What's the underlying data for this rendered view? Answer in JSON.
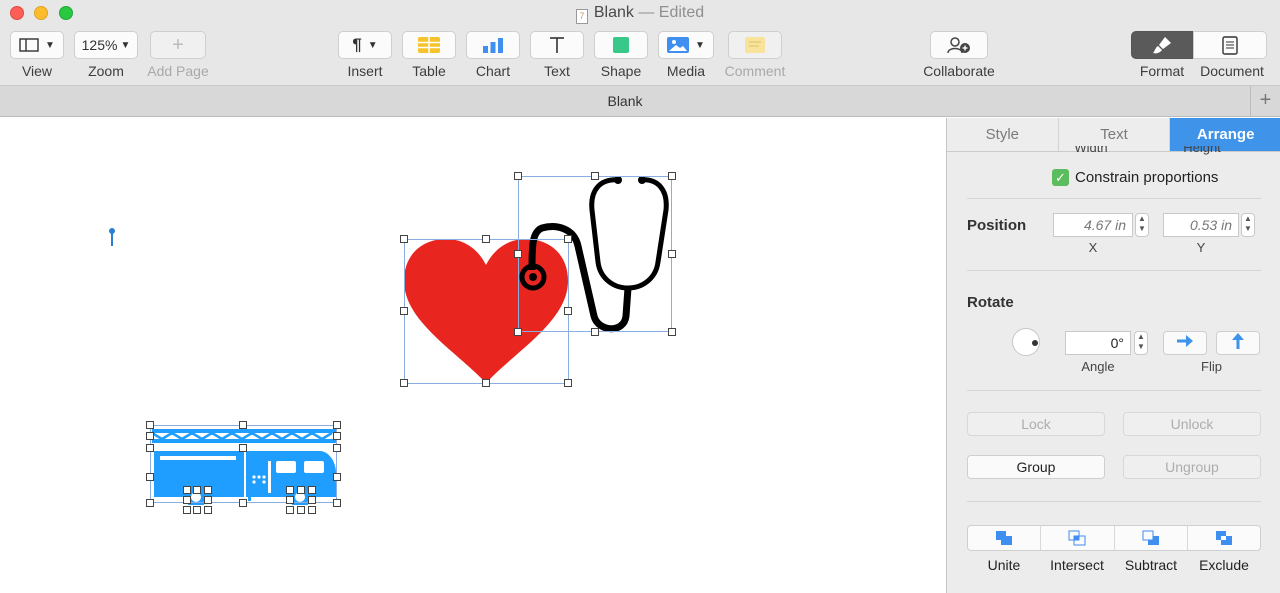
{
  "window": {
    "title": "Blank",
    "status": "— Edited"
  },
  "toolbar": {
    "view": "View",
    "zoom_value": "125%",
    "zoom": "Zoom",
    "add_page": "Add Page",
    "insert": "Insert",
    "table": "Table",
    "chart": "Chart",
    "text": "Text",
    "shape": "Shape",
    "media": "Media",
    "comment": "Comment",
    "collaborate": "Collaborate",
    "format": "Format",
    "document": "Document"
  },
  "tabbar": {
    "title": "Blank",
    "add": "+"
  },
  "inspector": {
    "tabs": [
      "Style",
      "Text",
      "Arrange"
    ],
    "active_tab": "Arrange",
    "width_label": "Width",
    "height_label": "Height",
    "constrain_label": "Constrain proportions",
    "position_label": "Position",
    "x_value": "4.67 in",
    "x_label": "X",
    "y_value": "0.53 in",
    "y_label": "Y",
    "rotate_label": "Rotate",
    "angle_value": "0°",
    "angle_label": "Angle",
    "flip_label": "Flip",
    "lock": "Lock",
    "unlock": "Unlock",
    "group": "Group",
    "ungroup": "Ungroup",
    "unite": "Unite",
    "intersect": "Intersect",
    "subtract": "Subtract",
    "exclude": "Exclude"
  },
  "colors": {
    "accent": "#3f93e8",
    "heart": "#e8261f",
    "truck": "#1f9eff"
  }
}
